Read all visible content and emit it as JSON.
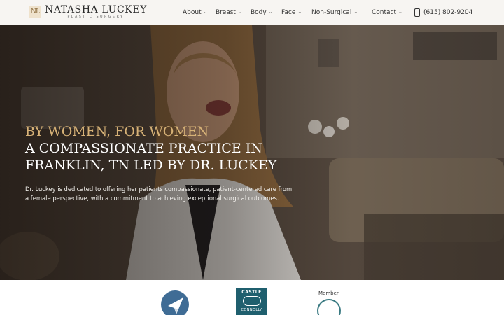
{
  "brand": {
    "monogram": "NL",
    "name": "NATASHA LUCKEY",
    "subtitle": "PLASTIC SURGERY"
  },
  "nav": {
    "items": [
      {
        "label": "About"
      },
      {
        "label": "Breast"
      },
      {
        "label": "Body"
      },
      {
        "label": "Face"
      },
      {
        "label": "Non-Surgical"
      },
      {
        "label": "Contact"
      }
    ],
    "phone": "(615) 802-9204"
  },
  "hero": {
    "kicker": "BY WOMEN, FOR WOMEN",
    "title_line1": "A COMPASSIONATE PRACTICE IN",
    "title_line2": "FRANKLIN, TN LED BY DR. LUCKEY",
    "body": "Dr. Luckey is dedicated to offering her patients compassionate, patient-centered care from a female perspective, with a commitment to achieving exceptional surgical outcomes."
  },
  "badges": {
    "castle_top": "CASTLE",
    "castle_bottom": "CONNOLLY",
    "member_label": "Member"
  },
  "colors": {
    "accent_gold": "#d7b277",
    "header_bg": "#f7f5f2",
    "castle_teal": "#1f5f6e",
    "badge_blue": "#3f6c95"
  }
}
